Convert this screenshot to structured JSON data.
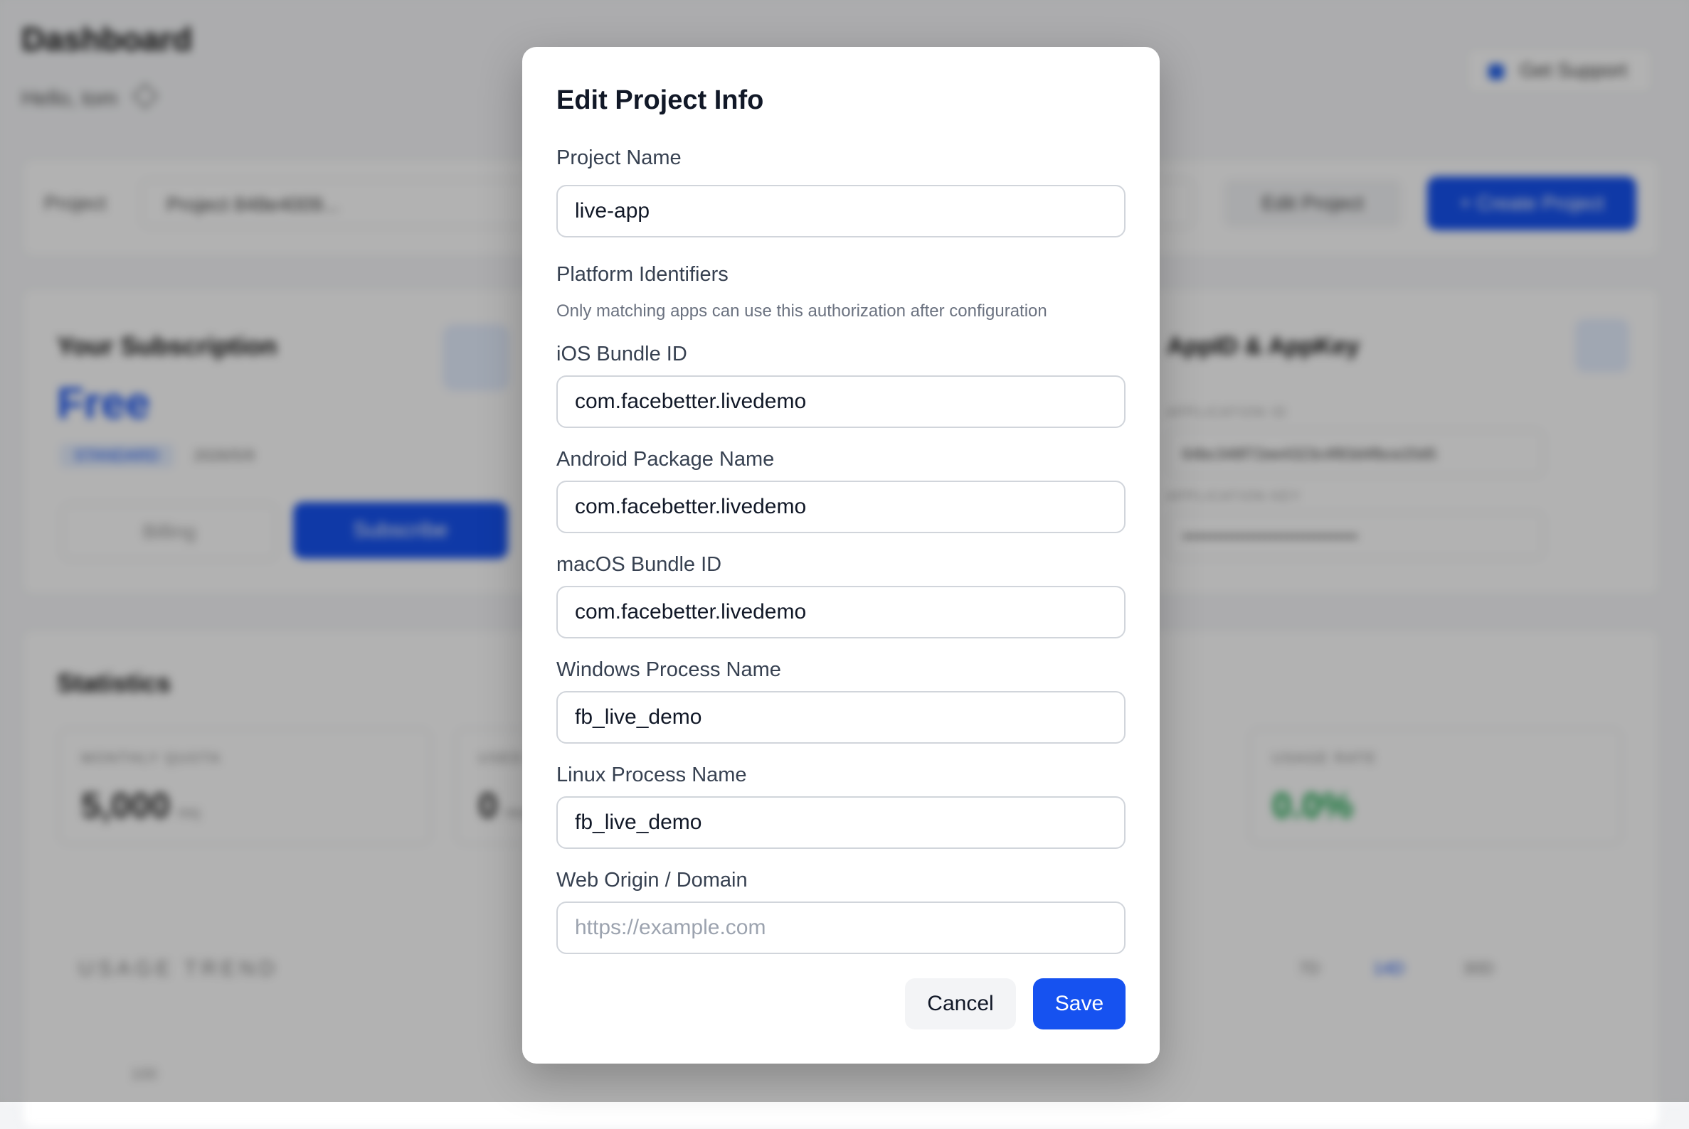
{
  "background": {
    "page_title": "Dashboard",
    "greeting": "Hello, tom",
    "support_button": "Get Support",
    "project_label": "Project",
    "project_select_value": "Project 848e4009...",
    "edit_project_button": "Edit Project",
    "create_project_button": "+ Create Project",
    "subscription": {
      "title": "Your Subscription",
      "plan": "Free",
      "status_badge": "STANDARD",
      "date": "2026/5/9",
      "billing_button": "Billing",
      "subscribe_button": "Subscribe"
    },
    "app_keys": {
      "title": "AppID & AppKey",
      "app_id_label": "APPLICATION ID",
      "app_id_value": "64bc348f72ee4323c4f83d4fbce20d5",
      "app_key_label": "APPLICATION KEY",
      "app_key_value": "••••••••••••••••••••••••••••••••"
    },
    "statistics": {
      "title": "Statistics",
      "cards": [
        {
          "label": "MONTHLY QUOTA",
          "value": "5,000",
          "unit": "req"
        },
        {
          "label": "USED",
          "value": "0",
          "unit": "req"
        },
        {
          "label": "USAGE RATE",
          "value": "0.0%"
        }
      ],
      "trend_title": "USAGE TREND",
      "ranges": [
        "7D",
        "14D",
        "30D"
      ],
      "y_tick": "100"
    }
  },
  "dialog": {
    "title": "Edit Project Info",
    "project_name_label": "Project Name",
    "project_name_value": "live-app",
    "platform_section_title": "Platform Identifiers",
    "platform_section_hint": "Only matching apps can use this authorization after configuration",
    "ios_label": "iOS Bundle ID",
    "ios_value": "com.facebetter.livedemo",
    "android_label": "Android Package Name",
    "android_value": "com.facebetter.livedemo",
    "macos_label": "macOS Bundle ID",
    "macos_value": "com.facebetter.livedemo",
    "windows_label": "Windows Process Name",
    "windows_value": "fb_live_demo",
    "linux_label": "Linux Process Name",
    "linux_value": "fb_live_demo",
    "web_label": "Web Origin / Domain",
    "web_value": "",
    "web_placeholder": "https://example.com",
    "cancel_label": "Cancel",
    "save_label": "Save"
  },
  "colors": {
    "primary": "#1652f0",
    "overlay": "rgba(0,0,0,0.30)",
    "success": "#16a34a"
  }
}
